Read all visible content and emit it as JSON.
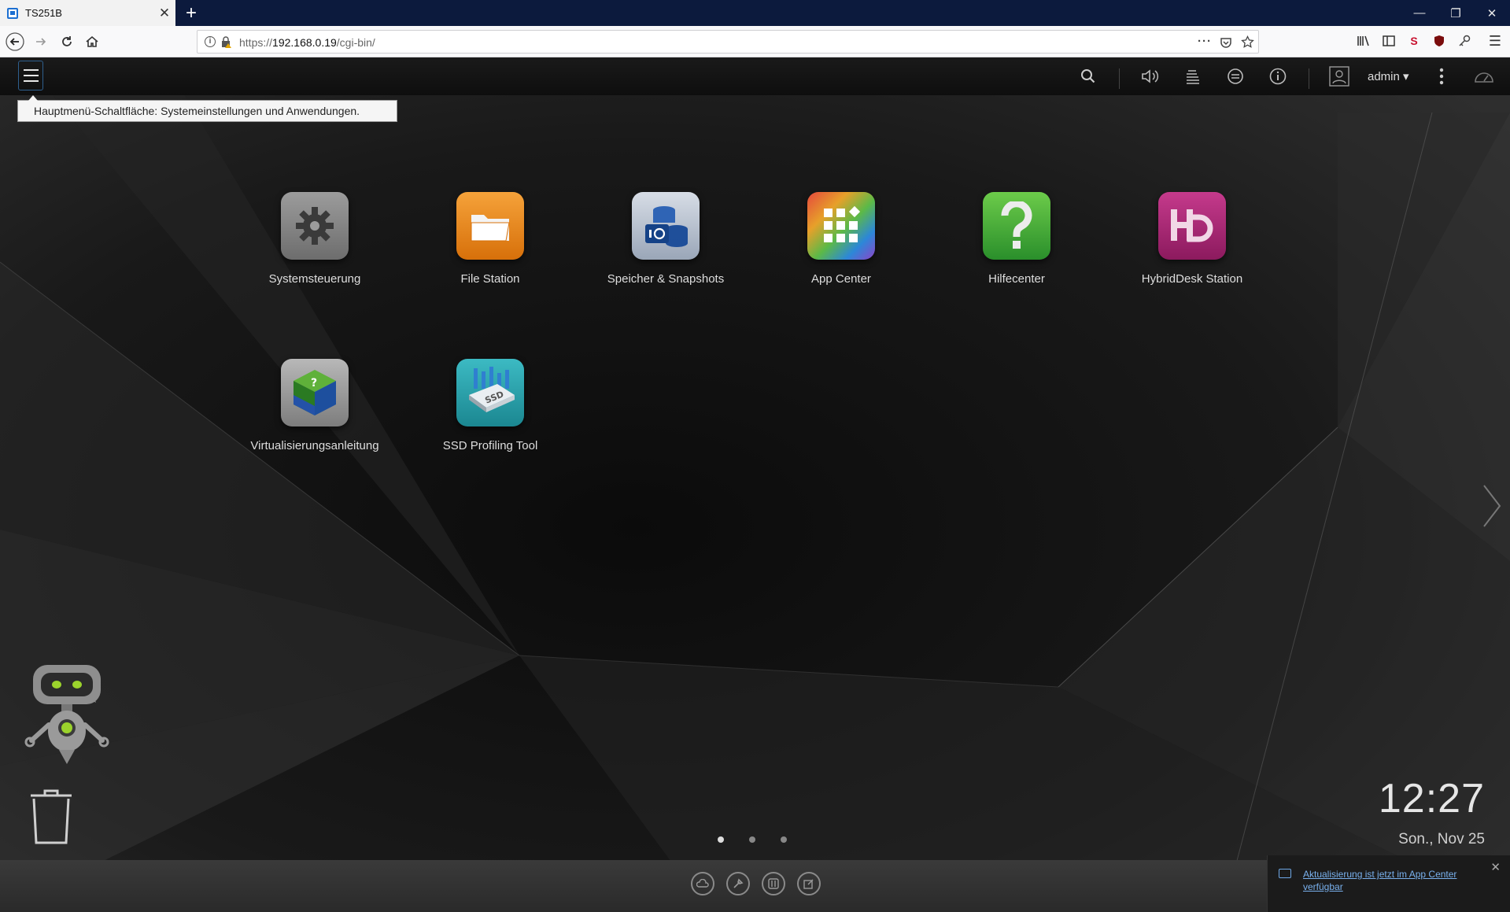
{
  "browser": {
    "tab_title": "TS251B",
    "url_prefix": "https://",
    "url_host": "192.168.0.19",
    "url_path": "/cgi-bin/"
  },
  "qts": {
    "menu_tooltip": "Hauptmenü-Schaltfläche: Systemeinstellungen und Anwendungen.",
    "user": "admin",
    "apps_row1": [
      {
        "label": "Systemsteuerung",
        "icon": "gear-icon"
      },
      {
        "label": "File Station",
        "icon": "folder-icon"
      },
      {
        "label": "Speicher & Snapshots",
        "icon": "storage-icon"
      },
      {
        "label": "App Center",
        "icon": "app-grid-icon"
      },
      {
        "label": "Hilfecenter",
        "icon": "question-icon"
      },
      {
        "label": "HybridDesk Station",
        "icon": "hd-icon"
      }
    ],
    "apps_row2": [
      {
        "label": "Virtualisierungsanleitung",
        "icon": "virtualization-cube-icon"
      },
      {
        "label": "SSD Profiling Tool",
        "icon": "ssd-icon"
      }
    ],
    "clock": {
      "time": "12:27",
      "date": "Son., Nov 25"
    },
    "pages": {
      "count": 3,
      "active": 1
    },
    "notification": "Aktualisierung ist jetzt im App Center verfügbar"
  },
  "colors": {
    "settings": "#8a8a8a",
    "file_station": "#e98a12",
    "storage": "#b9c3d2",
    "help": "#48b043",
    "hybriddesk": "#b3297a",
    "ssd": "#2aa0a8",
    "link": "#79b1ee"
  }
}
